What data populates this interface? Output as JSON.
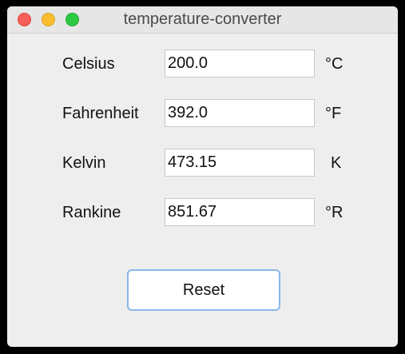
{
  "window": {
    "title": "temperature-converter"
  },
  "rows": [
    {
      "label": "Celsius",
      "value": "200.0",
      "unit": "°C"
    },
    {
      "label": "Fahrenheit",
      "value": "392.0",
      "unit": "°F"
    },
    {
      "label": "Kelvin",
      "value": "473.15",
      "unit": "K"
    },
    {
      "label": "Rankine",
      "value": "851.67",
      "unit": "°R"
    }
  ],
  "actions": {
    "reset_label": "Reset"
  },
  "colors": {
    "close": "#f65f58",
    "minimize": "#f9bd2e",
    "maximize": "#2ec942",
    "focus_ring": "#8bb5ea"
  }
}
